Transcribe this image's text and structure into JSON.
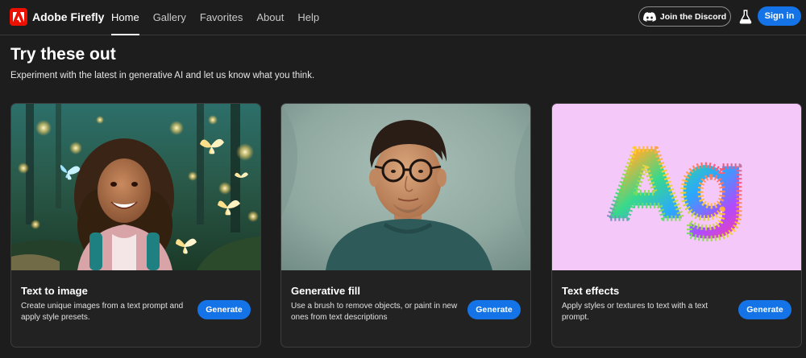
{
  "header": {
    "app_name": "Adobe Firefly",
    "logo_icon": "adobe-logo-icon",
    "brand_color": "#eb1000",
    "nav": [
      {
        "label": "Home",
        "active": true
      },
      {
        "label": "Gallery",
        "active": false
      },
      {
        "label": "Favorites",
        "active": false
      },
      {
        "label": "About",
        "active": false
      },
      {
        "label": "Help",
        "active": false
      }
    ],
    "discord_label": "Join the Discord",
    "discord_icon": "discord-icon",
    "labs_icon": "flask-icon",
    "signin_label": "Sign in",
    "accent_color": "#1473e6"
  },
  "main": {
    "title": "Try these out",
    "subtitle": "Experiment with the latest in generative AI and let us know what you think.",
    "cards": [
      {
        "title": "Text to image",
        "description": "Create unique images from a text prompt and apply style presets.",
        "button": "Generate",
        "image": "girl with butterflies in glowing forest"
      },
      {
        "title": "Generative fill",
        "description": "Use a brush to remove objects, or paint in new ones from text descriptions",
        "button": "Generate",
        "image": "portrait of man with glasses"
      },
      {
        "title": "Text effects",
        "description": "Apply styles or textures to text with a text prompt.",
        "button": "Generate",
        "image": "furry rainbow letters on pink",
        "art_text": "Ag"
      }
    ]
  }
}
